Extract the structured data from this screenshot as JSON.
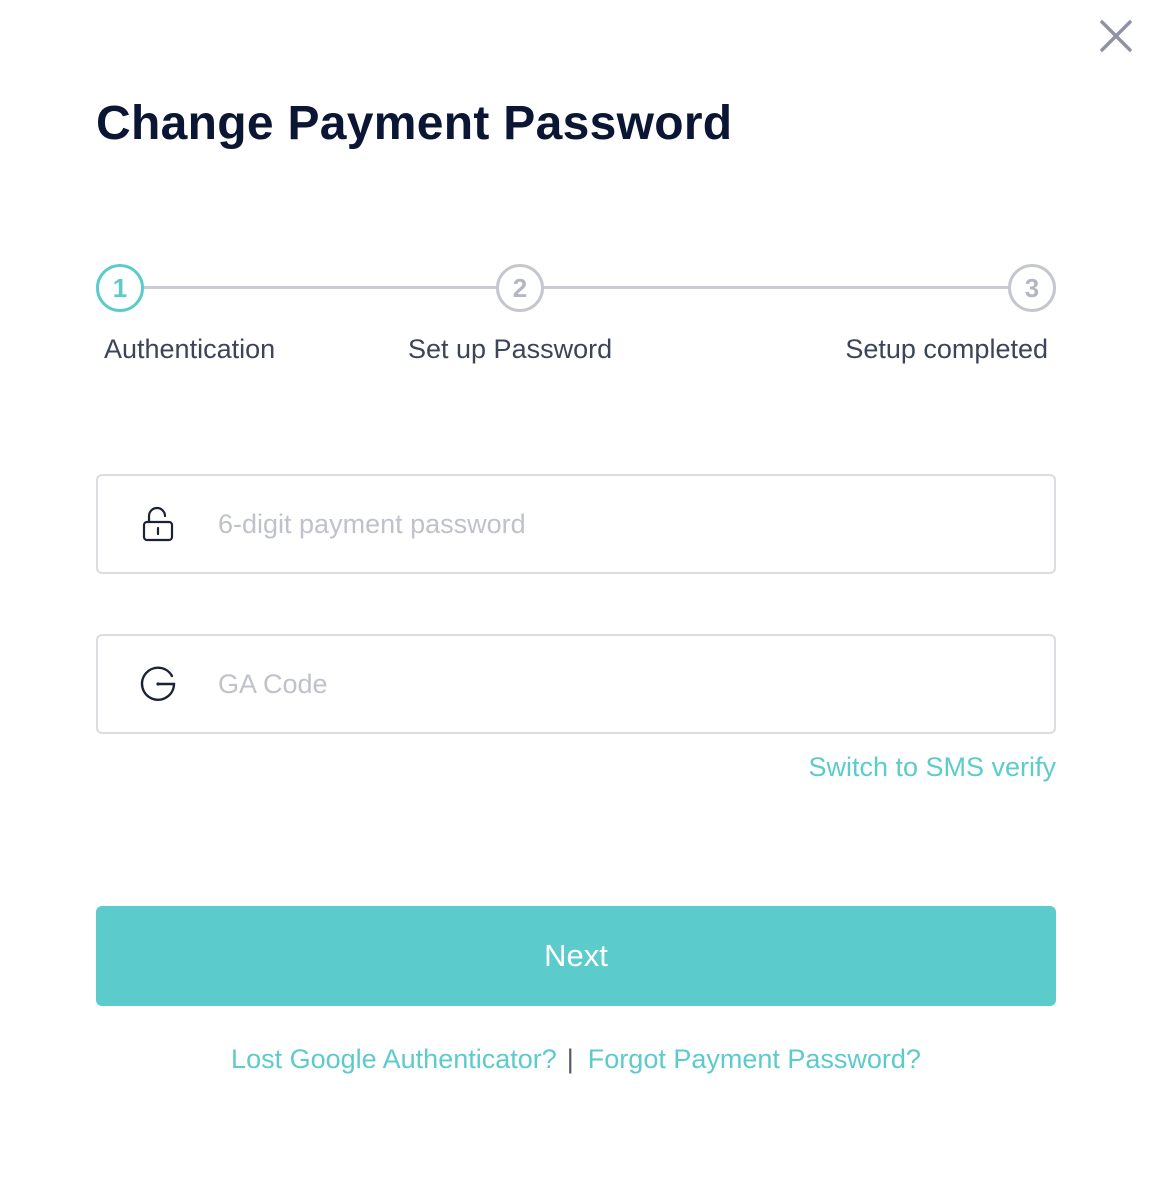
{
  "dialog": {
    "title": "Change Payment Password",
    "close_icon": "close-icon"
  },
  "stepper": {
    "steps": [
      {
        "number": "1",
        "label": "Authentication",
        "active": true
      },
      {
        "number": "2",
        "label": "Set up Password",
        "active": false
      },
      {
        "number": "3",
        "label": "Setup completed",
        "active": false
      }
    ]
  },
  "form": {
    "password": {
      "placeholder": "6-digit payment password",
      "value": "",
      "icon": "lock-icon"
    },
    "ga_code": {
      "placeholder": "GA Code",
      "value": "",
      "icon": "google-authenticator-icon"
    },
    "switch_link": "Switch to SMS verify",
    "next_label": "Next"
  },
  "footer": {
    "lost_ga": "Lost Google Authenticator?",
    "separator": "|",
    "forgot_password": "Forgot Payment Password?"
  },
  "colors": {
    "accent": "#5ccbcc",
    "title": "#0b1634",
    "inactive": "#c5c7cf"
  }
}
